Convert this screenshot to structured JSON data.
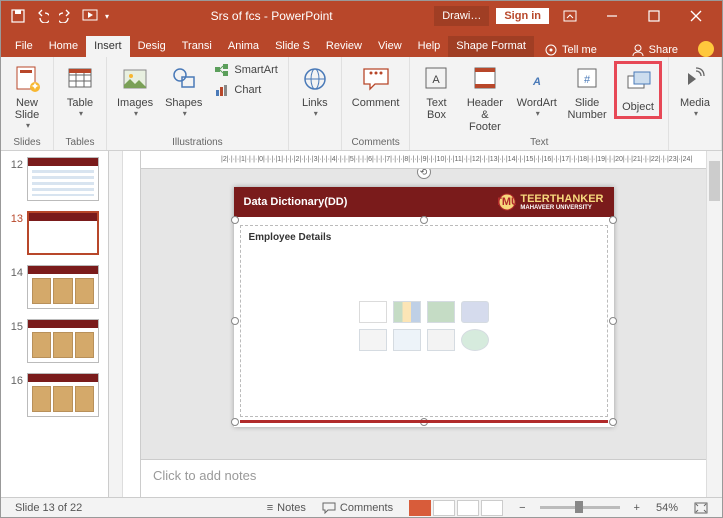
{
  "app": {
    "title": "Srs of fcs  -  PowerPoint",
    "context_tab": "Drawi…",
    "signin": "Sign in"
  },
  "qat": {
    "save": "💾",
    "undo": "↶",
    "redo": "↷",
    "start": "▷"
  },
  "tabs": {
    "file": "File",
    "home": "Home",
    "insert": "Insert",
    "design": "Desig",
    "transitions": "Transi",
    "animations": "Anima",
    "slideshow": "Slide S",
    "review": "Review",
    "view": "View",
    "help": "Help",
    "shapeformat": "Shape Format",
    "tellme": "Tell me",
    "share": "Share"
  },
  "ribbon": {
    "slides": {
      "newslide": "New\nSlide",
      "group": "Slides"
    },
    "tables": {
      "table": "Table",
      "group": "Tables"
    },
    "illustrations": {
      "images": "Images",
      "shapes": "Shapes",
      "smartart": "SmartArt",
      "chart": "Chart",
      "group": "Illustrations"
    },
    "links": {
      "links": "Links",
      "group": ""
    },
    "comments": {
      "comment": "Comment",
      "group": "Comments"
    },
    "text": {
      "textbox": "Text\nBox",
      "headerfooter": "Header\n& Footer",
      "wordart": "WordArt",
      "slidenumber": "Slide\nNumber",
      "object": "Object",
      "group": "Text"
    },
    "media": {
      "media": "Media",
      "group": ""
    }
  },
  "slide": {
    "title": "Data Dictionary(DD)",
    "subhead": "Employee Details",
    "brand_main": "TEERTHANKER",
    "brand_sub": "MAHAVEER UNIVERSITY"
  },
  "thumbs": [
    {
      "n": "12"
    },
    {
      "n": "13"
    },
    {
      "n": "14"
    },
    {
      "n": "15"
    },
    {
      "n": "16"
    }
  ],
  "notes": {
    "placeholder": "Click to add notes"
  },
  "status": {
    "slide": "Slide 13 of 22",
    "notes": "Notes",
    "comments": "Comments",
    "zoom": "54%"
  },
  "ruler_h": "|2|·|·|·|1|·|·|·|0|·|·|·|1|·|·|·|2|·|·|·|3|·|·|·|4|·|·|·|5|·|·|·|6|·|·|·|7|·|·|·|8|·|·|·|9|·|·|10|·|·|11|·|·|12|·|·|13|·|·|14|·|·|15|·|·|16|·|·|17|·|·|18|·|·|19|·|·|20|·|·|21|·|·|22|·|·|23|·|24|"
}
